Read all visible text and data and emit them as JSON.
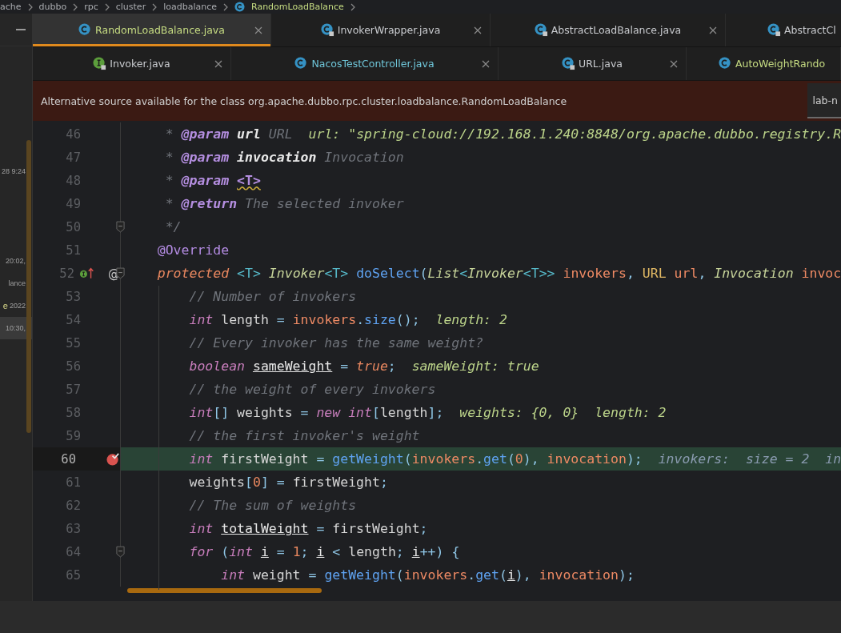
{
  "breadcrumb": [
    {
      "label": "ache",
      "icon": false
    },
    {
      "label": "dubbo",
      "icon": false
    },
    {
      "label": "rpc",
      "icon": false
    },
    {
      "label": "cluster",
      "icon": false
    },
    {
      "label": "loadbalance",
      "icon": false
    },
    {
      "label": "RandomLoadBalance",
      "icon": true
    }
  ],
  "side_panel": [
    {
      "text": "28 9:24",
      "selected": false
    },
    {
      "text": "20:02,",
      "selected": false
    },
    {
      "text": "lance",
      "selected": false
    },
    {
      "lead": "e",
      "text": "2022",
      "selected": false
    },
    {
      "text": "10:30,",
      "selected": true
    }
  ],
  "tab_rows": [
    [
      {
        "label": "RandomLoadBalance.java",
        "selected": true,
        "kind": "class",
        "locked": false,
        "closable": true,
        "color": "#c6dc82"
      },
      {
        "label": "InvokerWrapper.java",
        "selected": false,
        "kind": "class",
        "locked": true,
        "closable": true,
        "color": "#c9cbcf"
      },
      {
        "label": "AbstractLoadBalance.java",
        "selected": false,
        "kind": "class",
        "locked": true,
        "closable": true,
        "color": "#c9cbcf"
      },
      {
        "label": "AbstractCl",
        "selected": false,
        "kind": "class",
        "locked": true,
        "closable": false,
        "color": "#c9cbcf"
      }
    ],
    [
      {
        "label": "Invoker.java",
        "selected": false,
        "kind": "interface",
        "locked": true,
        "closable": true,
        "color": "#c9cbcf"
      },
      {
        "label": "NacosTestController.java",
        "selected": false,
        "kind": "class",
        "locked": false,
        "closable": true,
        "color": "#6fc6d9"
      },
      {
        "label": "URL.java",
        "selected": false,
        "kind": "class",
        "locked": true,
        "closable": true,
        "color": "#c9cbcf"
      },
      {
        "label": "AutoWeightRando",
        "selected": false,
        "kind": "class",
        "locked": false,
        "closable": false,
        "color": "#c6dc82"
      }
    ]
  ],
  "banner": {
    "message": "Alternative source available for the class org.apache.dubbo.rpc.cluster.loadbalance.RandomLoadBalance",
    "source_select": "lab-n"
  },
  "lines": [
    {
      "number": "46",
      "current": false,
      "fold": false,
      "tokens": [
        {
          "text": "     * ",
          "kind": "doc"
        },
        {
          "text": "@param ",
          "kind": "doctag"
        },
        {
          "text": "url",
          "kind": "docparam"
        },
        {
          "text": " URL",
          "kind": "doc"
        },
        {
          "text": "  url: \"spring-cloud://192.168.1.240:8848/org.apache.dubbo.registry.R",
          "kind": "hint"
        }
      ]
    },
    {
      "number": "47",
      "current": false,
      "fold": false,
      "tokens": [
        {
          "text": "     * ",
          "kind": "doc"
        },
        {
          "text": "@param ",
          "kind": "doctag"
        },
        {
          "text": "invocation",
          "kind": "docparam"
        },
        {
          "text": " Invocation",
          "kind": "doc"
        }
      ]
    },
    {
      "number": "48",
      "current": false,
      "fold": false,
      "tokens": [
        {
          "text": "     * ",
          "kind": "doc"
        },
        {
          "text": "@param ",
          "kind": "doctag"
        },
        {
          "text": "<T>",
          "kind": "docwarn"
        }
      ]
    },
    {
      "number": "49",
      "current": false,
      "fold": false,
      "tokens": [
        {
          "text": "     * ",
          "kind": "doc"
        },
        {
          "text": "@return",
          "kind": "doctag"
        },
        {
          "text": " The selected invoker",
          "kind": "doc"
        }
      ]
    },
    {
      "number": "50",
      "current": false,
      "fold": true,
      "tokens": [
        {
          "text": "     */",
          "kind": "doc"
        }
      ]
    },
    {
      "number": "51",
      "current": false,
      "fold": false,
      "tokens": [
        {
          "text": "    @Override",
          "kind": "ann"
        }
      ]
    },
    {
      "number": "52",
      "current": false,
      "fold": true,
      "markers": [
        {
          "kind": "implements"
        },
        {
          "kind": "annotated",
          "glyph": "@"
        }
      ],
      "tokens": [
        {
          "text": "    protected ",
          "kind": "kw2"
        },
        {
          "text": "<T> ",
          "kind": "gen"
        },
        {
          "text": "Invoker",
          "kind": "type"
        },
        {
          "text": "<T> ",
          "kind": "gen"
        },
        {
          "text": "doSelect",
          "kind": "fn"
        },
        {
          "text": "(",
          "kind": "op"
        },
        {
          "text": "List",
          "kind": "type"
        },
        {
          "text": "<",
          "kind": "gen"
        },
        {
          "text": "Invoker",
          "kind": "type"
        },
        {
          "text": "<T>> ",
          "kind": "gen"
        },
        {
          "text": "invokers",
          "kind": "var"
        },
        {
          "text": ", ",
          "kind": "op"
        },
        {
          "text": "URL ",
          "kind": "cls"
        },
        {
          "text": "url",
          "kind": "var"
        },
        {
          "text": ", ",
          "kind": "op"
        },
        {
          "text": "Invocation ",
          "kind": "type"
        },
        {
          "text": "invoc",
          "kind": "var"
        }
      ]
    },
    {
      "number": "53",
      "current": false,
      "fold": false,
      "tokens": [
        {
          "text": "        // Number of invokers",
          "kind": "cmt"
        }
      ]
    },
    {
      "number": "54",
      "current": false,
      "fold": false,
      "tokens": [
        {
          "text": "        int",
          "kind": "kw"
        },
        {
          "text": " length "
        },
        {
          "text": "= ",
          "kind": "op"
        },
        {
          "text": "invokers",
          "kind": "var"
        },
        {
          "text": ".",
          "kind": "op"
        },
        {
          "text": "size",
          "kind": "fn"
        },
        {
          "text": "();",
          "kind": "op"
        },
        {
          "text": "  length: 2",
          "kind": "hint"
        }
      ]
    },
    {
      "number": "55",
      "current": false,
      "fold": false,
      "tokens": [
        {
          "text": "        // Every invoker has the same weight?",
          "kind": "cmt"
        }
      ]
    },
    {
      "number": "56",
      "current": false,
      "fold": false,
      "tokens": [
        {
          "text": "        boolean ",
          "kind": "kw"
        },
        {
          "text": "sameWeight",
          "kind": "u"
        },
        {
          "text": " = ",
          "kind": "op"
        },
        {
          "text": "true",
          "kind": "kw2"
        },
        {
          "text": ";",
          "kind": "op"
        },
        {
          "text": "  sameWeight: true",
          "kind": "hint"
        }
      ]
    },
    {
      "number": "57",
      "current": false,
      "fold": false,
      "tokens": [
        {
          "text": "        // the weight of every invokers",
          "kind": "cmt"
        }
      ]
    },
    {
      "number": "58",
      "current": false,
      "fold": false,
      "tokens": [
        {
          "text": "        int",
          "kind": "kw"
        },
        {
          "text": "[]",
          "kind": "op"
        },
        {
          "text": " weights "
        },
        {
          "text": "= ",
          "kind": "op"
        },
        {
          "text": "new int",
          "kind": "kw"
        },
        {
          "text": "[",
          "kind": "op"
        },
        {
          "text": "length"
        },
        {
          "text": "];",
          "kind": "op"
        },
        {
          "text": "  weights: {0, 0}  length: 2",
          "kind": "hint"
        }
      ]
    },
    {
      "number": "59",
      "current": false,
      "fold": false,
      "tokens": [
        {
          "text": "        // the first invoker's weight",
          "kind": "cmt"
        }
      ]
    },
    {
      "number": "60",
      "current": true,
      "fold": false,
      "markers": [
        {
          "kind": "breakpoint"
        }
      ],
      "tokens": [
        {
          "text": "        int",
          "kind": "kw"
        },
        {
          "text": " firstWeight "
        },
        {
          "text": "= ",
          "kind": "op"
        },
        {
          "text": "getWeight",
          "kind": "fn"
        },
        {
          "text": "(",
          "kind": "op"
        },
        {
          "text": "invokers",
          "kind": "var"
        },
        {
          "text": ".",
          "kind": "op"
        },
        {
          "text": "get",
          "kind": "fn"
        },
        {
          "text": "(",
          "kind": "op"
        },
        {
          "text": "0",
          "kind": "num"
        },
        {
          "text": "), ",
          "kind": "op"
        },
        {
          "text": "invocation",
          "kind": "var"
        },
        {
          "text": ");",
          "kind": "op"
        },
        {
          "text": "  invokers:  size = 2  in",
          "kind": "hint2"
        }
      ]
    },
    {
      "number": "61",
      "current": false,
      "fold": false,
      "tokens": [
        {
          "text": "        weights"
        },
        {
          "text": "[",
          "kind": "op"
        },
        {
          "text": "0",
          "kind": "num"
        },
        {
          "text": "] = ",
          "kind": "op"
        },
        {
          "text": "firstWeight"
        },
        {
          "text": ";",
          "kind": "op"
        }
      ]
    },
    {
      "number": "62",
      "current": false,
      "fold": false,
      "tokens": [
        {
          "text": "        // The sum of weights",
          "kind": "cmt"
        }
      ]
    },
    {
      "number": "63",
      "current": false,
      "fold": false,
      "tokens": [
        {
          "text": "        int ",
          "kind": "kw"
        },
        {
          "text": "totalWeight",
          "kind": "u"
        },
        {
          "text": " = ",
          "kind": "op"
        },
        {
          "text": "firstWeight"
        },
        {
          "text": ";",
          "kind": "op"
        }
      ]
    },
    {
      "number": "64",
      "current": false,
      "fold": true,
      "tokens": [
        {
          "text": "        for ",
          "kind": "kw"
        },
        {
          "text": "(",
          "kind": "op"
        },
        {
          "text": "int ",
          "kind": "kw"
        },
        {
          "text": "i",
          "kind": "u"
        },
        {
          "text": " = ",
          "kind": "op"
        },
        {
          "text": "1",
          "kind": "num"
        },
        {
          "text": "; ",
          "kind": "op"
        },
        {
          "text": "i",
          "kind": "u"
        },
        {
          "text": " < ",
          "kind": "op"
        },
        {
          "text": "length"
        },
        {
          "text": "; ",
          "kind": "op"
        },
        {
          "text": "i",
          "kind": "u"
        },
        {
          "text": "++) {",
          "kind": "op"
        }
      ]
    },
    {
      "number": "65",
      "current": false,
      "fold": false,
      "tokens": [
        {
          "text": "            int",
          "kind": "kw"
        },
        {
          "text": " weight "
        },
        {
          "text": "= ",
          "kind": "op"
        },
        {
          "text": "getWeight",
          "kind": "fn"
        },
        {
          "text": "(",
          "kind": "op"
        },
        {
          "text": "invokers",
          "kind": "var"
        },
        {
          "text": ".",
          "kind": "op"
        },
        {
          "text": "get",
          "kind": "fn"
        },
        {
          "text": "(",
          "kind": "op"
        },
        {
          "text": "i",
          "kind": "u"
        },
        {
          "text": "), ",
          "kind": "op"
        },
        {
          "text": "invocation",
          "kind": "var"
        },
        {
          "text": ");",
          "kind": "op"
        }
      ]
    }
  ]
}
